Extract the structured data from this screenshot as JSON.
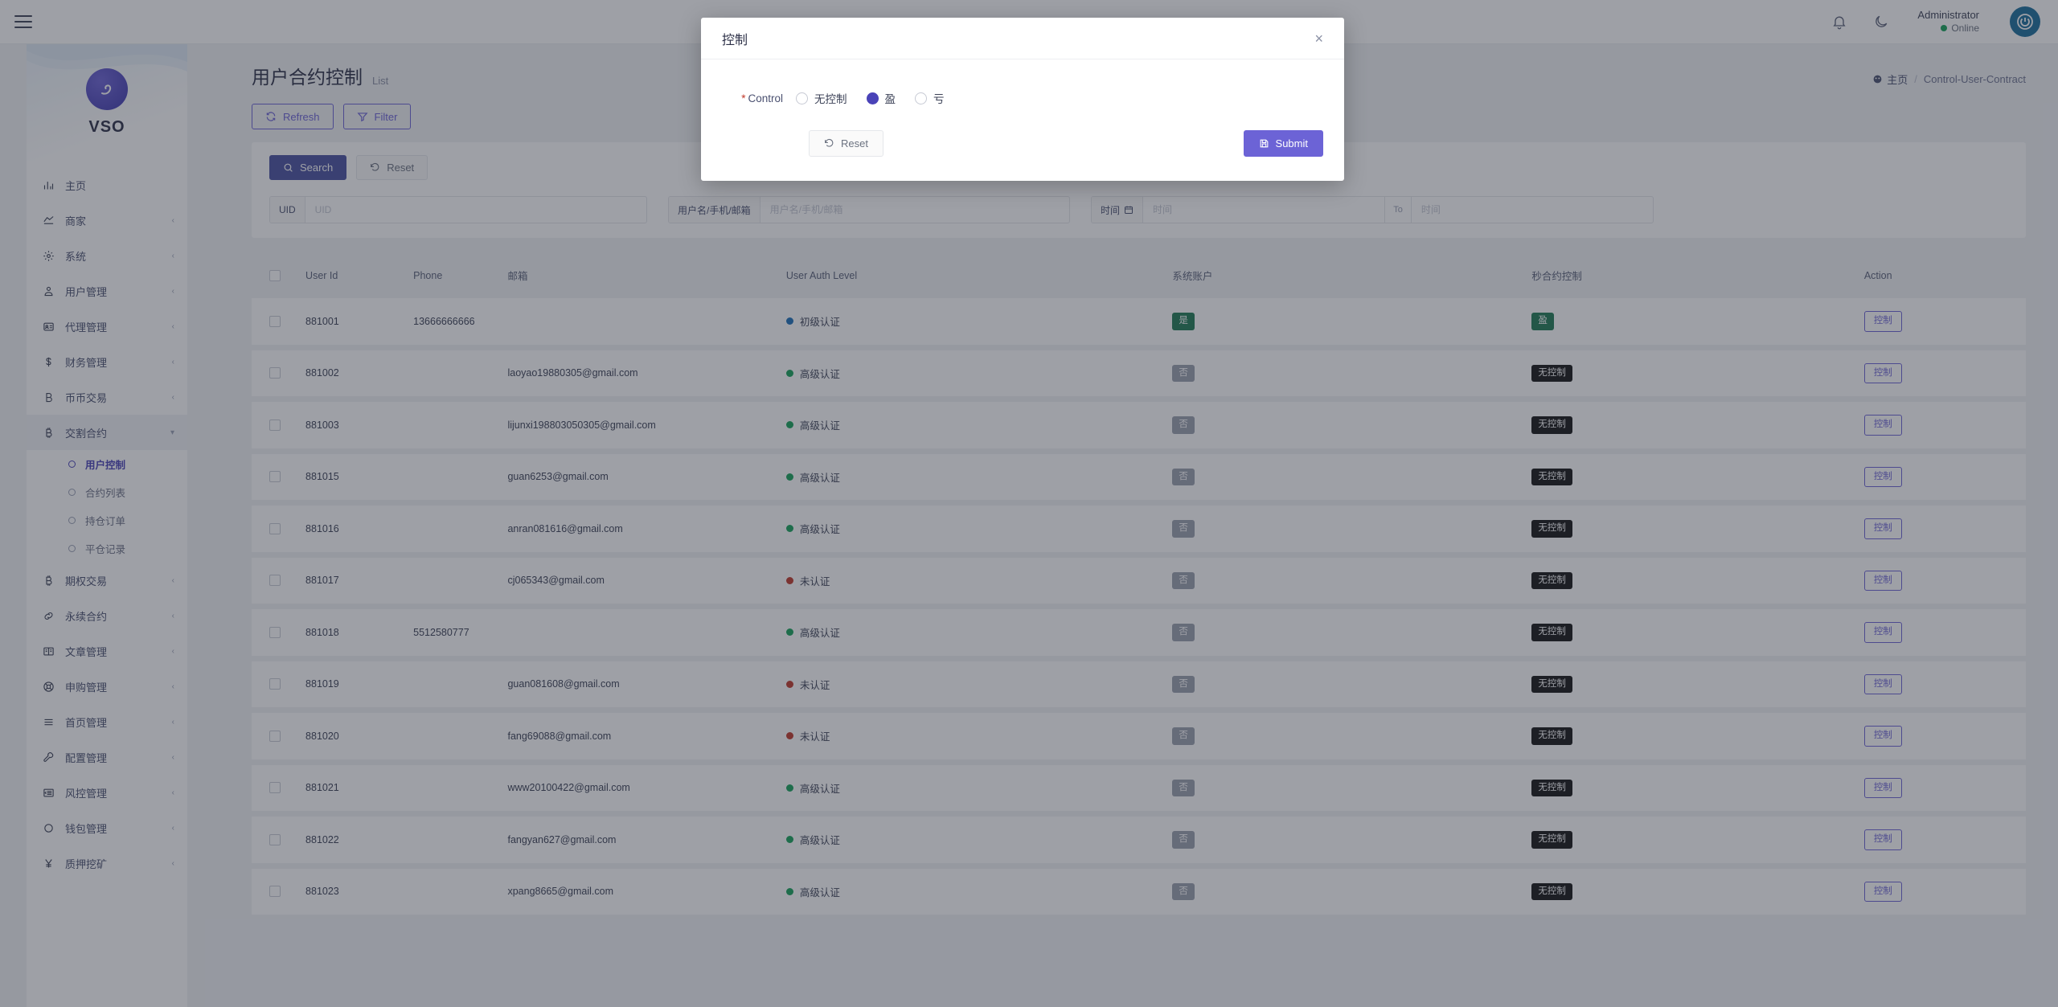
{
  "topbar": {
    "menu_toggle": "menu",
    "user_name": "Administrator",
    "user_status": "Online"
  },
  "sidebar": {
    "brand": "VSO",
    "items": [
      {
        "label": "主页",
        "icon": "bar-chart-icon",
        "expandable": false
      },
      {
        "label": "商家",
        "icon": "merchant-icon",
        "expandable": true
      },
      {
        "label": "系统",
        "icon": "gear-icon",
        "expandable": true
      },
      {
        "label": "用户管理",
        "icon": "user-icon",
        "expandable": true
      },
      {
        "label": "代理管理",
        "icon": "id-card-icon",
        "expandable": true
      },
      {
        "label": "财务管理",
        "icon": "dollar-icon",
        "expandable": true
      },
      {
        "label": "币币交易",
        "icon": "bitcoin-b-icon",
        "expandable": true
      },
      {
        "label": "交割合约",
        "icon": "bitcoin-icon",
        "expandable": true,
        "open": true
      },
      {
        "label": "期权交易",
        "icon": "bitcoin-icon",
        "expandable": true
      },
      {
        "label": "永续合约",
        "icon": "link-icon",
        "expandable": true
      },
      {
        "label": "文章管理",
        "icon": "book-icon",
        "expandable": true
      },
      {
        "label": "申购管理",
        "icon": "lifebuoy-icon",
        "expandable": true
      },
      {
        "label": "首页管理",
        "icon": "list-icon",
        "expandable": true
      },
      {
        "label": "配置管理",
        "icon": "wrench-icon",
        "expandable": true
      },
      {
        "label": "风控管理",
        "icon": "indent-icon",
        "expandable": true
      },
      {
        "label": "钱包管理",
        "icon": "circle-icon",
        "expandable": true
      },
      {
        "label": "质押挖矿",
        "icon": "yen-icon",
        "expandable": true
      }
    ],
    "submenu": [
      {
        "label": "用户控制",
        "active": true
      },
      {
        "label": "合约列表",
        "active": false
      },
      {
        "label": "持仓订单",
        "active": false
      },
      {
        "label": "平仓记录",
        "active": false
      }
    ]
  },
  "page": {
    "title": "用户合约控制",
    "subtitle": "List",
    "breadcrumb_home": "主页",
    "breadcrumb_sep": "/",
    "breadcrumb_current": "Control-User-Contract",
    "refresh_label": "Refresh",
    "filter_label": "Filter"
  },
  "search_panel": {
    "search_label": "Search",
    "reset_label": "Reset",
    "fields": [
      {
        "label": "UID",
        "placeholder": "UID",
        "value": ""
      },
      {
        "label": "用户名/手机/邮箱",
        "placeholder": "用户名/手机/邮箱",
        "value": ""
      }
    ],
    "date": {
      "label": "时间",
      "placeholder_from": "时间",
      "separator": "To",
      "placeholder_to": "时间",
      "value_from": "",
      "value_to": ""
    }
  },
  "table": {
    "columns": [
      "",
      "User Id",
      "Phone",
      "邮箱",
      "User Auth Level",
      "系统账户",
      "秒合约控制",
      "Action"
    ],
    "action_label": "控制",
    "rows": [
      {
        "user_id": "881001",
        "phone": "13666666666",
        "email": "",
        "auth": "初级认证",
        "auth_color": "#1d6fb8",
        "sys": "是",
        "sys_style": "green",
        "sec": "盈",
        "sec_style": "green"
      },
      {
        "user_id": "881002",
        "phone": "",
        "email": "laoyao19880305@gmail.com",
        "auth": "高级认证",
        "auth_color": "#17a25a",
        "sys": "否",
        "sys_style": "gray",
        "sec": "无控制",
        "sec_style": "black"
      },
      {
        "user_id": "881003",
        "phone": "",
        "email": "lijunxi198803050305@gmail.com",
        "auth": "高级认证",
        "auth_color": "#17a25a",
        "sys": "否",
        "sys_style": "gray",
        "sec": "无控制",
        "sec_style": "black"
      },
      {
        "user_id": "881015",
        "phone": "",
        "email": "guan6253@gmail.com",
        "auth": "高级认证",
        "auth_color": "#17a25a",
        "sys": "否",
        "sys_style": "gray",
        "sec": "无控制",
        "sec_style": "black"
      },
      {
        "user_id": "881016",
        "phone": "",
        "email": "anran081616@gmail.com",
        "auth": "高级认证",
        "auth_color": "#17a25a",
        "sys": "否",
        "sys_style": "gray",
        "sec": "无控制",
        "sec_style": "black"
      },
      {
        "user_id": "881017",
        "phone": "",
        "email": "cj065343@gmail.com",
        "auth": "未认证",
        "auth_color": "#c0392b",
        "sys": "否",
        "sys_style": "gray",
        "sec": "无控制",
        "sec_style": "black"
      },
      {
        "user_id": "881018",
        "phone": "5512580777",
        "email": "",
        "auth": "高级认证",
        "auth_color": "#17a25a",
        "sys": "否",
        "sys_style": "gray",
        "sec": "无控制",
        "sec_style": "black"
      },
      {
        "user_id": "881019",
        "phone": "",
        "email": "guan081608@gmail.com",
        "auth": "未认证",
        "auth_color": "#c0392b",
        "sys": "否",
        "sys_style": "gray",
        "sec": "无控制",
        "sec_style": "black"
      },
      {
        "user_id": "881020",
        "phone": "",
        "email": "fang69088@gmail.com",
        "auth": "未认证",
        "auth_color": "#c0392b",
        "sys": "否",
        "sys_style": "gray",
        "sec": "无控制",
        "sec_style": "black"
      },
      {
        "user_id": "881021",
        "phone": "",
        "email": "www20100422@gmail.com",
        "auth": "高级认证",
        "auth_color": "#17a25a",
        "sys": "否",
        "sys_style": "gray",
        "sec": "无控制",
        "sec_style": "black"
      },
      {
        "user_id": "881022",
        "phone": "",
        "email": "fangyan627@gmail.com",
        "auth": "高级认证",
        "auth_color": "#17a25a",
        "sys": "否",
        "sys_style": "gray",
        "sec": "无控制",
        "sec_style": "black"
      },
      {
        "user_id": "881023",
        "phone": "",
        "email": "xpang8665@gmail.com",
        "auth": "高级认证",
        "auth_color": "#17a25a",
        "sys": "否",
        "sys_style": "gray",
        "sec": "无控制",
        "sec_style": "black"
      }
    ]
  },
  "modal": {
    "title": "控制",
    "close": "×",
    "field_label": "Control",
    "required_mark": "*",
    "options": [
      {
        "label": "无控制",
        "checked": false
      },
      {
        "label": "盈",
        "checked": true
      },
      {
        "label": "亏",
        "checked": false
      }
    ],
    "reset_label": "Reset",
    "submit_label": "Submit"
  },
  "colors": {
    "accent": "#4a43b8",
    "primary_btn": "#4a50a0",
    "outline": "#6c63d6",
    "green": "#1f7a54",
    "black_badge": "#141414"
  }
}
